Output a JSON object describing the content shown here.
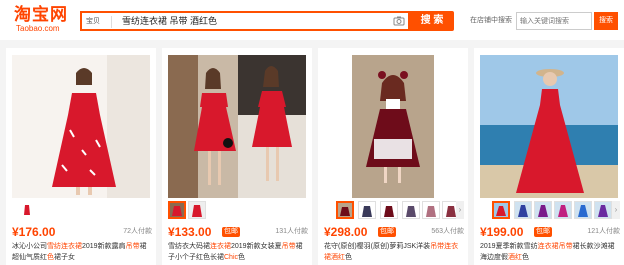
{
  "header": {
    "logo_cn": "淘宝网",
    "logo_en": "Taobao.com",
    "search_tab": "宝贝",
    "search_query": "雪纺连衣裙 吊带 酒红色",
    "search_button": "搜 索",
    "shop_search_label": "在店铺中搜索",
    "shop_search_placeholder": "输入关键词搜索",
    "shop_search_button": "搜索"
  },
  "products": [
    {
      "price": "¥176.00",
      "badge": "",
      "sold": "72人付款",
      "title_plain_1": "冰沁小公司",
      "title_hl_1": "雪纺连衣裙",
      "title_plain_2": "2019新款露肩",
      "title_hl_2": "吊带",
      "title_plain_3": "裙超仙气质红",
      "title_hl_3": "色",
      "title_plain_4": "裙子女"
    },
    {
      "price": "¥133.00",
      "badge": "包邮",
      "sold": "131人付款",
      "title_plain_1": "雪纺衣大码裙",
      "title_hl_1": "连衣裙",
      "title_plain_2": "2019新款女装夏",
      "title_hl_2": "吊带",
      "title_plain_3": "裙子小个子红色长裙",
      "title_hl_3": "Chic",
      "title_plain_4": "色"
    },
    {
      "price": "¥298.00",
      "badge": "包邮",
      "sold": "563人付款",
      "title_plain_1": "花守(原创)樱羽(原创)萝莉JSK洋装",
      "title_hl_1": "吊带连衣裙",
      "title_plain_2": "",
      "title_hl_2": "",
      "title_plain_3": "",
      "title_hl_3": "酒红",
      "title_plain_4": "色"
    },
    {
      "price": "¥199.00",
      "badge": "包邮",
      "sold": "121人付款",
      "title_plain_1": "2019夏季新款雪纺",
      "title_hl_1": "连衣裙吊带",
      "title_plain_2": "",
      "title_hl_2": "",
      "title_plain_3": "裙长款沙滩裙海边度假",
      "title_hl_3": "酒红",
      "title_plain_4": "色"
    }
  ]
}
